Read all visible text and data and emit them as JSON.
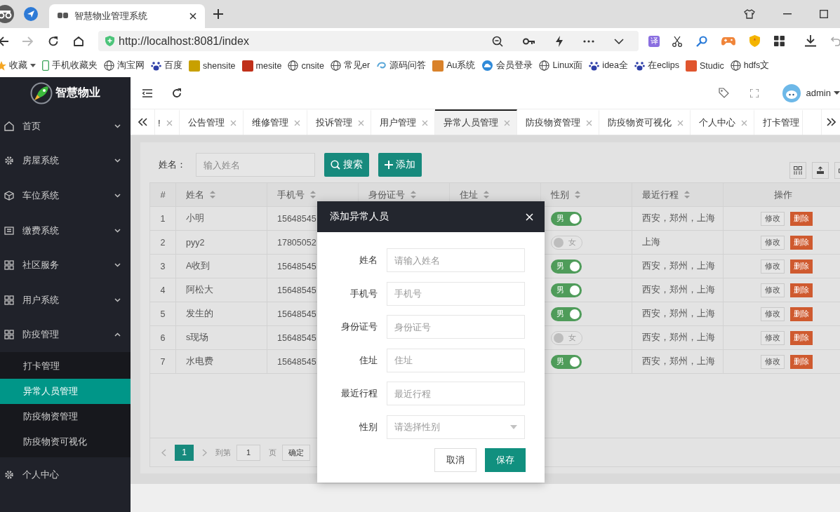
{
  "browser": {
    "tab_title": "智慧物业管理系统",
    "url": "http://localhost:8081/index",
    "translate_label": "译",
    "bookmarks": [
      {
        "label": "收藏",
        "kind": "star"
      },
      {
        "label": "手机收藏夹",
        "kind": "phone"
      },
      {
        "label": "淘宝网",
        "kind": "globe"
      },
      {
        "label": "百度",
        "kind": "paw"
      },
      {
        "label": "shensite",
        "kind": "tile",
        "color": "#c8a000"
      },
      {
        "label": "mesite",
        "kind": "tile",
        "color": "#c0301a"
      },
      {
        "label": "cnsite",
        "kind": "globe"
      },
      {
        "label": "常见er",
        "kind": "globe"
      },
      {
        "label": "源码问答",
        "kind": "swirl"
      },
      {
        "label": "Au系统",
        "kind": "tile",
        "color": "#d9822b"
      },
      {
        "label": "会员登录",
        "kind": "cloud"
      },
      {
        "label": "Linux面",
        "kind": "globe"
      },
      {
        "label": "idea全",
        "kind": "paw"
      },
      {
        "label": "在eclips",
        "kind": "paw"
      },
      {
        "label": "Studic",
        "kind": "tile",
        "color": "#e0552e"
      },
      {
        "label": "hdfs文",
        "kind": "globe"
      }
    ]
  },
  "sidebar": {
    "logo": "智慧物业",
    "menu": [
      {
        "label": "首页",
        "kind": "home",
        "expanded": false,
        "selected": false
      },
      {
        "label": "房屋系统",
        "kind": "gear",
        "expanded": false,
        "selected": false
      },
      {
        "label": "车位系统",
        "kind": "cube",
        "expanded": false,
        "selected": false
      },
      {
        "label": "缴费系统",
        "kind": "card",
        "expanded": false,
        "selected": false
      },
      {
        "label": "社区服务",
        "kind": "grid",
        "expanded": false,
        "selected": false
      },
      {
        "label": "用户系统",
        "kind": "grid",
        "expanded": false,
        "selected": false
      },
      {
        "label": "防疫管理",
        "kind": "grid",
        "expanded": true,
        "selected": false,
        "children": [
          {
            "label": "打卡管理",
            "selected": false
          },
          {
            "label": "异常人员管理",
            "selected": true
          },
          {
            "label": "防疫物资管理",
            "selected": false
          },
          {
            "label": "防疫物资可视化",
            "selected": false
          }
        ]
      },
      {
        "label": "个人中心",
        "kind": "gear",
        "selected": false
      }
    ]
  },
  "header": {
    "user": "admin"
  },
  "tabs": [
    {
      "label": "!",
      "closable": true,
      "selected": false
    },
    {
      "label": "公告管理",
      "closable": true,
      "selected": false
    },
    {
      "label": "维修管理",
      "closable": true,
      "selected": false
    },
    {
      "label": "投诉管理",
      "closable": true,
      "selected": false
    },
    {
      "label": "用户管理",
      "closable": true,
      "selected": false
    },
    {
      "label": "异常人员管理",
      "closable": true,
      "selected": true
    },
    {
      "label": "防疫物资管理",
      "closable": true,
      "selected": false
    },
    {
      "label": "防疫物资可视化",
      "closable": true,
      "selected": false
    },
    {
      "label": "个人中心",
      "closable": true,
      "selected": false
    },
    {
      "label": "打卡管理",
      "closable": false,
      "selected": false
    }
  ],
  "filter": {
    "label": "姓名：",
    "placeholder": "输入姓名",
    "search": "搜索",
    "add": "添加"
  },
  "table": {
    "columns": [
      {
        "label": "#",
        "sortable": false
      },
      {
        "label": "姓名",
        "sortable": true
      },
      {
        "label": "手机号",
        "sortable": true
      },
      {
        "label": "身份证号",
        "sortable": true
      },
      {
        "label": "住址",
        "sortable": true
      },
      {
        "label": "性别",
        "sortable": true
      },
      {
        "label": "最近行程",
        "sortable": true
      },
      {
        "label": "操作",
        "sortable": false
      }
    ],
    "rows": [
      {
        "index": "1",
        "name": "小明",
        "phone": "15648545",
        "gender": "男",
        "on": true,
        "trip": "西安，郑州，上海",
        "edit": "修改",
        "delete": "删除"
      },
      {
        "index": "2",
        "name": "pyy2",
        "phone": "17805052",
        "gender": "女",
        "on": false,
        "trip": "上海",
        "edit": "修改",
        "delete": "删除"
      },
      {
        "index": "3",
        "name": "A收到",
        "phone": "15648545",
        "gender": "男",
        "on": true,
        "trip": "西安，郑州，上海",
        "edit": "修改",
        "delete": "删除"
      },
      {
        "index": "4",
        "name": "阿松大",
        "phone": "15648545",
        "gender": "男",
        "on": true,
        "trip": "西安，郑州，上海",
        "edit": "修改",
        "delete": "删除"
      },
      {
        "index": "5",
        "name": "发生的",
        "phone": "15648545",
        "gender": "男",
        "on": true,
        "trip": "西安，郑州，上海",
        "edit": "修改",
        "delete": "删除"
      },
      {
        "index": "6",
        "name": "s现场",
        "phone": "15648545",
        "gender": "女",
        "on": false,
        "trip": "西安，郑州，上海",
        "edit": "修改",
        "delete": "删除"
      },
      {
        "index": "7",
        "name": "水电费",
        "phone": "15648545",
        "gender": "男",
        "on": true,
        "trip": "西安，郑州，上海",
        "edit": "修改",
        "delete": "删除"
      }
    ]
  },
  "pagination": {
    "pages": [
      {
        "label": "1",
        "selected": true
      }
    ],
    "goto": "到第",
    "page_value": "1",
    "page_unit": "页",
    "confirm": "确定"
  },
  "dialog": {
    "title": "添加异常人员",
    "fields": [
      {
        "label": "姓名",
        "placeholder": "请输入姓名",
        "kind": "input"
      },
      {
        "label": "手机号",
        "placeholder": "手机号",
        "kind": "input"
      },
      {
        "label": "身份证号",
        "placeholder": "身份证号",
        "kind": "input"
      },
      {
        "label": "住址",
        "placeholder": "住址",
        "kind": "input"
      },
      {
        "label": "最近行程",
        "placeholder": "最近行程",
        "kind": "input"
      },
      {
        "label": "性别",
        "placeholder": "请选择性别",
        "kind": "select"
      }
    ],
    "cancel": "取消",
    "save": "保存"
  }
}
